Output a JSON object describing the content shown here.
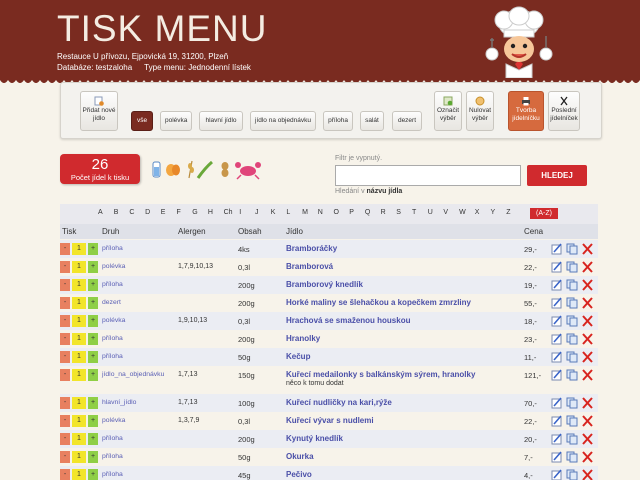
{
  "header": {
    "title": "TISK MENU",
    "address": "Restauce U přívozu, Ejpovická 19, 31200, Plzeň",
    "database": "Databáze: testzaloha",
    "menu_type": "Type menu: Jednodenní lístek"
  },
  "toolbar": {
    "add_meal": "Přidat nové jídlo",
    "filters": [
      "vše",
      "polévka",
      "hlavní jídlo",
      "jídlo na objednávku",
      "příloha",
      "salát",
      "dezert"
    ],
    "selected_filter": "vše",
    "mark_selection": "Označit výběr",
    "reset_selection": "Nulovat výběr",
    "create_menu": "Tvorba jídelníčku",
    "last_menus": "Poslední jídelníček"
  },
  "counter": {
    "count": "26",
    "label": "Počet jídel k tisku"
  },
  "search": {
    "filter_label": "Filtr je vypnutý.",
    "value": "",
    "hint_prefix": "Hledání v",
    "hint_bold": "názvu jídla",
    "button": "HLEDEJ"
  },
  "alphabet": [
    "A",
    "B",
    "C",
    "D",
    "E",
    "F",
    "G",
    "H",
    "Ch",
    "I",
    "J",
    "K",
    "L",
    "M",
    "N",
    "O",
    "P",
    "Q",
    "R",
    "S",
    "T",
    "U",
    "V",
    "W",
    "X",
    "Y",
    "Z"
  ],
  "alphabet_all": "(A-Z)",
  "table": {
    "headers": {
      "tisk": "Tisk",
      "druh": "Druh",
      "alergen": "Alergen",
      "obsah": "Obsah",
      "jidlo": "Jídlo",
      "cena": "Cena"
    },
    "rows": [
      {
        "qty": "1",
        "druh": "příloha",
        "alergen": "",
        "obsah": "4ks",
        "jidlo": "Bramboráčky",
        "note": "",
        "cena": "29,-"
      },
      {
        "qty": "1",
        "druh": "polévka",
        "alergen": "1,7,9,10,13",
        "obsah": "0,3l",
        "jidlo": "Bramborová",
        "note": "",
        "cena": "22,-"
      },
      {
        "qty": "1",
        "druh": "příloha",
        "alergen": "",
        "obsah": "200g",
        "jidlo": "Bramborový knedlík",
        "note": "",
        "cena": "19,-"
      },
      {
        "qty": "1",
        "druh": "dezert",
        "alergen": "",
        "obsah": "200g",
        "jidlo": "Horké maliny se šlehačkou a kopečkem zmrzliny",
        "note": "",
        "cena": "55,-"
      },
      {
        "qty": "1",
        "druh": "polévka",
        "alergen": "1,9,10,13",
        "obsah": "0,3l",
        "jidlo": "Hrachová se smaženou houskou",
        "note": "",
        "cena": "18,-"
      },
      {
        "qty": "1",
        "druh": "příloha",
        "alergen": "",
        "obsah": "200g",
        "jidlo": "Hranolky",
        "note": "",
        "cena": "23,-"
      },
      {
        "qty": "1",
        "druh": "příloha",
        "alergen": "",
        "obsah": "50g",
        "jidlo": "Kečup",
        "note": "",
        "cena": "11,-"
      },
      {
        "qty": "1",
        "druh": "jídlo_na_objednávku",
        "alergen": "1,7,13",
        "obsah": "150g",
        "jidlo": "Kuřecí medailonky s balkánským sýrem, hranolky",
        "note": "něco k tomu dodat",
        "cena": "121,-"
      },
      {
        "qty": "1",
        "druh": "hlavní_jídlo",
        "alergen": "1,7,13",
        "obsah": "100g",
        "jidlo": "Kuřecí nudličky na kari,rýže",
        "note": "",
        "cena": "70,-"
      },
      {
        "qty": "1",
        "druh": "polévka",
        "alergen": "1,3,7,9",
        "obsah": "0,3l",
        "jidlo": "Kuřecí vývar s nudlemi",
        "note": "",
        "cena": "22,-"
      },
      {
        "qty": "1",
        "druh": "příloha",
        "alergen": "",
        "obsah": "200g",
        "jidlo": "Kynutý knedlík",
        "note": "",
        "cena": "20,-"
      },
      {
        "qty": "1",
        "druh": "příloha",
        "alergen": "",
        "obsah": "50g",
        "jidlo": "Okurka",
        "note": "",
        "cena": "7,-"
      },
      {
        "qty": "1",
        "druh": "příloha",
        "alergen": "",
        "obsah": "45g",
        "jidlo": "Pečivo",
        "note": "",
        "cena": "4,-"
      }
    ]
  },
  "colors": {
    "header_bg": "#7a2b20",
    "accent_red": "#d02a2e",
    "active_orange": "#d66a3e",
    "link_blue": "#4a4fa8"
  }
}
